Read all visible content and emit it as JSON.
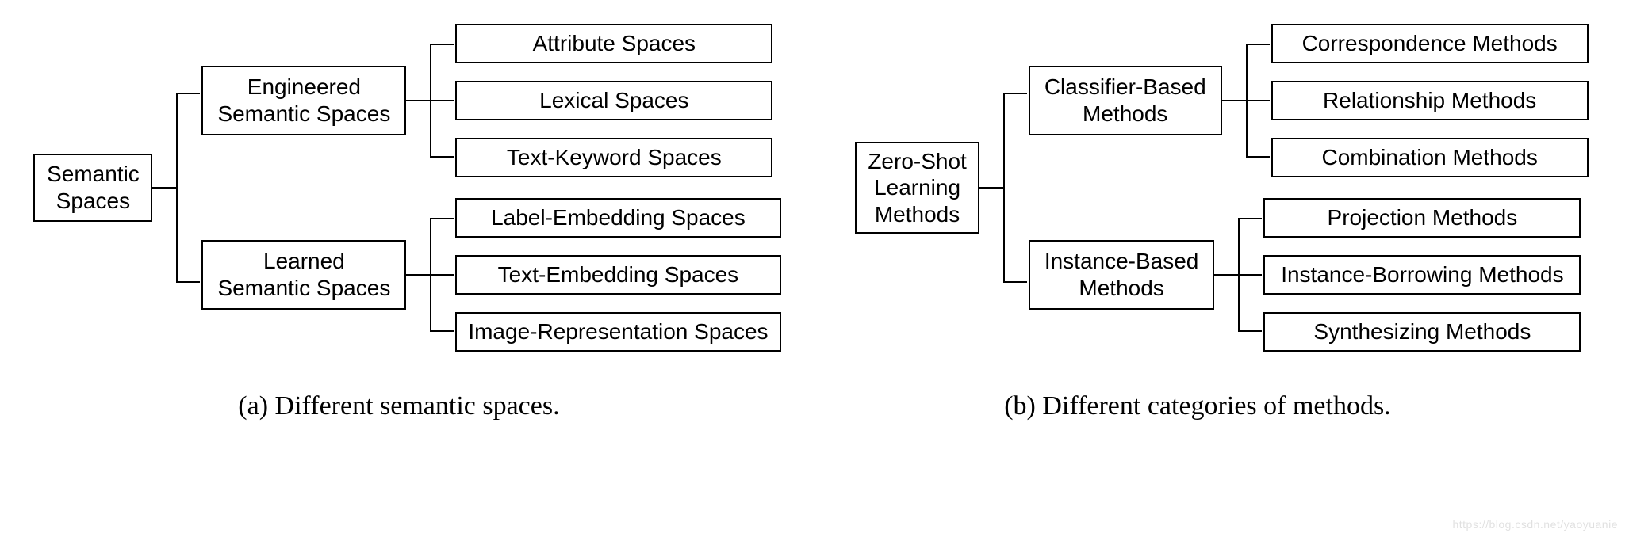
{
  "left": {
    "root": "Semantic\nSpaces",
    "branches": [
      {
        "label": "Engineered\nSemantic Spaces",
        "leaves": [
          "Attribute Spaces",
          "Lexical Spaces",
          "Text-Keyword Spaces"
        ]
      },
      {
        "label": "Learned\nSemantic Spaces",
        "leaves": [
          "Label-Embedding Spaces",
          "Text-Embedding Spaces",
          "Image-Representation Spaces"
        ]
      }
    ],
    "caption": "(a) Different semantic spaces."
  },
  "right": {
    "root": "Zero-Shot\nLearning\nMethods",
    "branches": [
      {
        "label": "Classifier-Based\nMethods",
        "leaves": [
          "Correspondence Methods",
          "Relationship Methods",
          "Combination Methods"
        ]
      },
      {
        "label": "Instance-Based\nMethods",
        "leaves": [
          "Projection Methods",
          "Instance-Borrowing Methods",
          "Synthesizing Methods"
        ]
      }
    ],
    "caption": "(b) Different categories of methods."
  },
  "watermark": "https://blog.csdn.net/yaoyuanie"
}
